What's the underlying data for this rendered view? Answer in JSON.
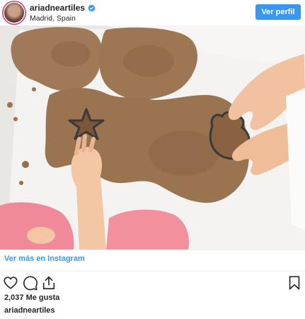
{
  "header": {
    "username": "ariadneartiles",
    "location": "Madrid, Spain",
    "verified_icon": "verified-badge-icon",
    "follow_label": "Ver perfil"
  },
  "photo": {
    "description_icon": "post-photo"
  },
  "link": {
    "label": "Ver más en Instagram"
  },
  "actions": {
    "icons": [
      "heart-icon",
      "comment-icon",
      "share-icon",
      "bookmark-icon"
    ]
  },
  "likes": {
    "label": "2,037 Me gusta"
  },
  "caption": {
    "username": "ariadneartiles"
  },
  "colors": {
    "accent": "#3897f0",
    "text": "#262626",
    "ring": "#e1306c"
  }
}
